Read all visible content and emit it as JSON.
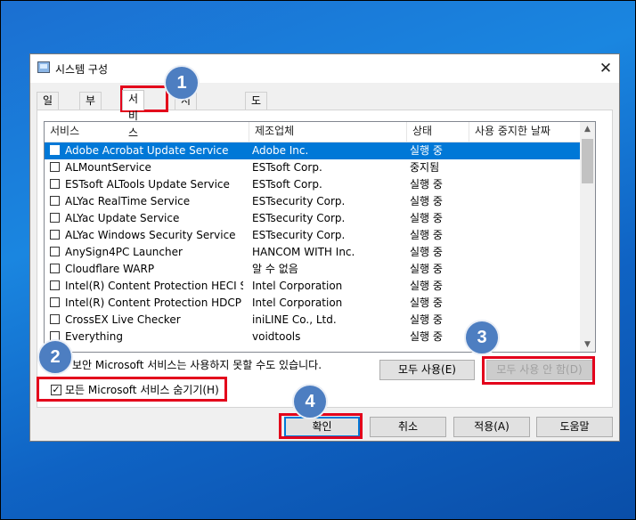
{
  "window": {
    "title": "시스템 구성",
    "close_glyph": "✕"
  },
  "tabs": [
    "일반",
    "부팅",
    "서비스",
    "시작프로그램",
    "도구"
  ],
  "active_tab": "서비스",
  "columns": [
    "서비스",
    "제조업체",
    "상태",
    "사용 중지한 날짜"
  ],
  "services": [
    {
      "name": "Adobe Acrobat Update Service",
      "manufacturer": "Adobe Inc.",
      "status": "실행 중"
    },
    {
      "name": "ALMountService",
      "manufacturer": "ESTsoft Corp.",
      "status": "중지됨"
    },
    {
      "name": "ESTsoft ALTools Update Service",
      "manufacturer": "ESTsoft Corp.",
      "status": "실행 중"
    },
    {
      "name": "ALYac RealTime Service",
      "manufacturer": "ESTsecurity Corp.",
      "status": "실행 중"
    },
    {
      "name": "ALYac Update Service",
      "manufacturer": "ESTsecurity Corp.",
      "status": "실행 중"
    },
    {
      "name": "ALYac Windows Security Service",
      "manufacturer": "ESTsecurity Corp.",
      "status": "실행 중"
    },
    {
      "name": "AnySign4PC Launcher",
      "manufacturer": "HANCOM WITH Inc.",
      "status": "실행 중"
    },
    {
      "name": "Cloudflare WARP",
      "manufacturer": "알 수 없음",
      "status": "실행 중"
    },
    {
      "name": "Intel(R) Content Protection HECI Se...",
      "manufacturer": "Intel Corporation",
      "status": "실행 중"
    },
    {
      "name": "Intel(R) Content Protection HDCP S...",
      "manufacturer": "Intel Corporation",
      "status": "실행 중"
    },
    {
      "name": "CrossEX Live Checker",
      "manufacturer": "iniLINE Co., Ltd.",
      "status": "실행 중"
    },
    {
      "name": "Everything",
      "manufacturer": "voidtools",
      "status": "실행 중"
    }
  ],
  "selected_row": 0,
  "notice": "보안 Microsoft 서비스는 사용하지 못할 수도 있습니다.",
  "buttons": {
    "enable_all": "모두 사용(E)",
    "disable_all": "모두 사용 안 함(D)",
    "ok": "확인",
    "cancel": "취소",
    "apply": "적용(A)",
    "help": "도움말"
  },
  "hide_ms": {
    "label": "모든 Microsoft 서비스 숨기기(H)",
    "checked": true,
    "check_glyph": "✓"
  },
  "scroll": {
    "up": "▲",
    "down": "▼"
  },
  "badges": [
    "1",
    "2",
    "3",
    "4"
  ],
  "colors": {
    "highlight": "#e3001b",
    "badge": "#4d7ec1",
    "selection": "#0078d7"
  }
}
